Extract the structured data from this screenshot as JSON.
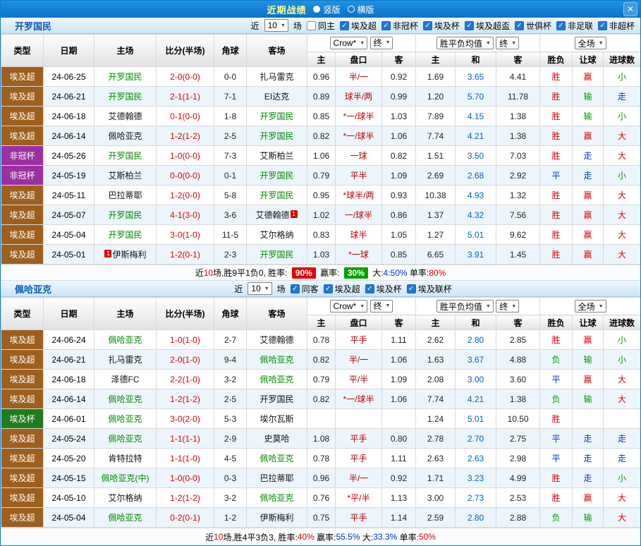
{
  "titlebar": {
    "title": "近期战绩",
    "radios": [
      {
        "label": "竖版",
        "selected": true
      },
      {
        "label": "横版",
        "selected": false
      }
    ],
    "close": "✕"
  },
  "table_head": {
    "type": "类型",
    "date": "日期",
    "home": "主场",
    "score": "比分(半场)",
    "corner": "角球",
    "away": "客场",
    "bookmaker": "Crow*",
    "final": "终",
    "avg": "胜平负均值",
    "fulltime": "全场",
    "odds_home": "主",
    "handicap": "盘口",
    "odds_away": "客",
    "eu_home": "主",
    "eu_draw": "和",
    "eu_away": "客",
    "result": "胜负",
    "hcap_result": "让球",
    "goals": "进球数"
  },
  "type_colors": {
    "埃及超": "#9d5f1e",
    "非冠杯": "#9b30a0",
    "埃及杯": "#1f7d1f"
  },
  "value_colors": {
    "胜": "#e00000",
    "平": "#0033dd",
    "负": "#009900",
    "赢": "#e00000",
    "输": "#009900",
    "走": "#0033dd",
    "大": "#e00000",
    "小": "#009900"
  },
  "sections": [
    {
      "team": "开罗国民",
      "filters": {
        "near": "近",
        "count": "10",
        "games": "场",
        "checkboxes": [
          {
            "label": "同主",
            "checked": false
          },
          {
            "label": "埃及超",
            "checked": true
          },
          {
            "label": "非冠杯",
            "checked": true
          },
          {
            "label": "埃及杯",
            "checked": true
          },
          {
            "label": "埃及超盃",
            "checked": true
          },
          {
            "label": "世俱杯",
            "checked": true
          },
          {
            "label": "非足联",
            "checked": true
          },
          {
            "label": "非超杯",
            "checked": true
          }
        ]
      },
      "rows": [
        {
          "type": "埃及超",
          "date": "24-06-25",
          "home": "开罗国民",
          "hf": true,
          "score": "2-0(0-0)",
          "corner": "0-0",
          "away": "扎马雷克",
          "af": false,
          "oh": "0.96",
          "hc": "半/一",
          "oa": "0.92",
          "eu": [
            "1.69",
            "3.65",
            "4.41"
          ],
          "res": "胜",
          "hres": "赢",
          "goal": "小"
        },
        {
          "type": "埃及超",
          "date": "24-06-21",
          "home": "开罗国民",
          "hf": true,
          "score": "2-1(1-1)",
          "corner": "7-1",
          "away": "EI达克",
          "af": false,
          "oh": "0.89",
          "hc": "球半/两",
          "oa": "0.99",
          "eu": [
            "1.20",
            "5.70",
            "11.78"
          ],
          "res": "胜",
          "hres": "输",
          "goal": "走"
        },
        {
          "type": "埃及超",
          "date": "24-06-18",
          "home": "艾德翰德",
          "hf": false,
          "score": "0-1(0-0)",
          "corner": "1-8",
          "away": "开罗国民",
          "af": true,
          "oh": "0.85",
          "hc": "*一/球半",
          "oa": "1.03",
          "eu": [
            "7.89",
            "4.15",
            "1.38"
          ],
          "res": "胜",
          "hres": "输",
          "goal": "小"
        },
        {
          "type": "埃及超",
          "date": "24-06-14",
          "home": "佩哈亚克",
          "hf": false,
          "score": "1-2(1-2)",
          "corner": "2-5",
          "away": "开罗国民",
          "af": true,
          "oh": "0.82",
          "hc": "*一/球半",
          "oa": "1.06",
          "eu": [
            "7.74",
            "4.21",
            "1.38"
          ],
          "res": "胜",
          "hres": "赢",
          "goal": "大"
        },
        {
          "type": "非冠杯",
          "date": "24-05-26",
          "home": "开罗国民",
          "hf": true,
          "score": "1-0(0-0)",
          "corner": "7-3",
          "away": "艾斯柏兰",
          "af": false,
          "oh": "1.06",
          "hc": "一球",
          "oa": "0.82",
          "eu": [
            "1.51",
            "3.50",
            "7.03"
          ],
          "res": "胜",
          "hres": "走",
          "goal": "大"
        },
        {
          "type": "非冠杯",
          "date": "24-05-19",
          "home": "艾斯柏兰",
          "hf": false,
          "score": "0-0(0-0)",
          "corner": "0-1",
          "away": "开罗国民",
          "af": true,
          "oh": "0.79",
          "hc": "平半",
          "oa": "1.09",
          "eu": [
            "2.69",
            "2.68",
            "2.92"
          ],
          "res": "平",
          "hres": "走",
          "goal": "小"
        },
        {
          "type": "埃及超",
          "date": "24-05-11",
          "home": "巴拉蒂耶",
          "hf": false,
          "score": "1-2(0-0)",
          "corner": "5-8",
          "away": "开罗国民",
          "af": true,
          "oh": "0.95",
          "hc": "*球半/两",
          "oa": "0.93",
          "eu": [
            "10.38",
            "4.93",
            "1.32"
          ],
          "res": "胜",
          "hres": "赢",
          "goal": "大"
        },
        {
          "type": "埃及超",
          "date": "24-05-07",
          "home": "开罗国民",
          "hf": true,
          "score": "4-1(3-0)",
          "corner": "3-6",
          "away": "艾德翰德",
          "af": false,
          "away_badge": "1",
          "oh": "1.02",
          "hc": "一/球半",
          "oa": "0.86",
          "eu": [
            "1.37",
            "4.32",
            "7.56"
          ],
          "res": "胜",
          "hres": "赢",
          "goal": "大"
        },
        {
          "type": "埃及超",
          "date": "24-05-04",
          "home": "开罗国民",
          "hf": true,
          "score": "3-0(1-0)",
          "corner": "11-5",
          "away": "艾尔格纳",
          "af": false,
          "oh": "0.83",
          "hc": "球半",
          "oa": "1.05",
          "eu": [
            "1.27",
            "5.01",
            "9.62"
          ],
          "res": "胜",
          "hres": "赢",
          "goal": "大"
        },
        {
          "type": "埃及超",
          "date": "24-05-01",
          "home": "伊斯梅利",
          "hf": false,
          "home_badge": "1",
          "score": "1-2(0-1)",
          "corner": "2-3",
          "away": "开罗国民",
          "af": true,
          "oh": "1.03",
          "hc": "*一球",
          "oa": "0.85",
          "eu": [
            "6.65",
            "3.91",
            "1.45"
          ],
          "res": "胜",
          "hres": "赢",
          "goal": "大"
        }
      ],
      "summary": {
        "parts": [
          {
            "t": "近"
          },
          {
            "t": "10",
            "c": "#e00000"
          },
          {
            "t": "场,胜9平1负0, 胜率: "
          },
          {
            "t": "90%",
            "badge": "#e80000"
          },
          {
            "t": " 赢率: "
          },
          {
            "t": "30%",
            "badge": "#00a000"
          },
          {
            "t": " 大:"
          },
          {
            "t": "4:50%",
            "c": "#0033dd"
          },
          {
            "t": " 单率:"
          },
          {
            "t": "80%",
            "c": "#e00000"
          }
        ]
      }
    },
    {
      "team": "佩哈亚克",
      "filters": {
        "near": "近",
        "count": "10",
        "games": "场",
        "checkboxes": [
          {
            "label": "同客",
            "checked": true
          },
          {
            "label": "埃及超",
            "checked": true
          },
          {
            "label": "埃及杯",
            "checked": true
          },
          {
            "label": "埃及联杯",
            "checked": true
          }
        ]
      },
      "rows": [
        {
          "type": "埃及超",
          "date": "24-06-24",
          "home": "佩哈亚克",
          "hf": true,
          "score": "1-0(1-0)",
          "corner": "2-7",
          "away": "艾德翰德",
          "af": false,
          "oh": "0.78",
          "hc": "平手",
          "oa": "1.11",
          "eu": [
            "2.62",
            "2.80",
            "2.85"
          ],
          "res": "胜",
          "hres": "赢",
          "goal": "小"
        },
        {
          "type": "埃及超",
          "date": "24-06-21",
          "home": "扎马雷克",
          "hf": false,
          "score": "2-0(1-0)",
          "corner": "9-4",
          "away": "佩哈亚克",
          "af": true,
          "oh": "0.82",
          "hc": "半/一",
          "oa": "1.06",
          "eu": [
            "1.63",
            "3.67",
            "4.88"
          ],
          "res": "负",
          "hres": "输",
          "goal": "小"
        },
        {
          "type": "埃及超",
          "date": "24-06-18",
          "home": "泽德FC",
          "hf": false,
          "score": "2-2(1-0)",
          "corner": "3-2",
          "away": "佩哈亚克",
          "af": true,
          "oh": "0.79",
          "hc": "平/半",
          "oa": "1.09",
          "eu": [
            "2.08",
            "3.00",
            "3.60"
          ],
          "res": "平",
          "hres": "赢",
          "goal": "大"
        },
        {
          "type": "埃及超",
          "date": "24-06-14",
          "home": "佩哈亚克",
          "hf": true,
          "score": "1-2(1-2)",
          "corner": "2-5",
          "away": "开罗国民",
          "af": false,
          "oh": "0.82",
          "hc": "*一/球半",
          "oa": "1.06",
          "eu": [
            "7.74",
            "4.21",
            "1.38"
          ],
          "res": "负",
          "hres": "输",
          "goal": "大"
        },
        {
          "type": "埃及杯",
          "date": "24-06-01",
          "home": "佩哈亚克",
          "hf": true,
          "score": "3-0(2-0)",
          "corner": "5-3",
          "away": "埃尔瓦斯",
          "af": false,
          "oh": "",
          "hc": "",
          "oa": "",
          "eu": [
            "1.24",
            "5.01",
            "10.50"
          ],
          "res": "胜",
          "hres": "",
          "goal": ""
        },
        {
          "type": "埃及超",
          "date": "24-05-24",
          "home": "佩哈亚克",
          "hf": true,
          "score": "1-1(1-1)",
          "corner": "2-9",
          "away": "史莫哈",
          "af": false,
          "oh": "1.08",
          "hc": "平手",
          "oa": "0.80",
          "eu": [
            "2.78",
            "2.70",
            "2.75"
          ],
          "res": "平",
          "hres": "走",
          "goal": "走"
        },
        {
          "type": "埃及超",
          "date": "24-05-20",
          "home": "肯特拉特",
          "hf": false,
          "score": "1-1(1-0)",
          "corner": "4-5",
          "away": "佩哈亚克",
          "af": true,
          "oh": "0.78",
          "hc": "平手",
          "oa": "1.11",
          "eu": [
            "2.63",
            "2.63",
            "2.98"
          ],
          "res": "平",
          "hres": "走",
          "goal": "走"
        },
        {
          "type": "埃及超",
          "date": "24-05-15",
          "home": "佩哈亚克(中)",
          "hf": true,
          "score": "1-0(0-0)",
          "corner": "0-3",
          "away": "巴拉蒂耶",
          "af": false,
          "oh": "0.96",
          "hc": "半/一",
          "oa": "0.92",
          "eu": [
            "1.71",
            "3.23",
            "4.99"
          ],
          "res": "胜",
          "hres": "走",
          "goal": "小"
        },
        {
          "type": "埃及超",
          "date": "24-05-10",
          "home": "艾尔格纳",
          "hf": false,
          "score": "1-2(1-2)",
          "corner": "3-2",
          "away": "佩哈亚克",
          "af": true,
          "oh": "0.76",
          "hc": "*平/半",
          "oa": "1.13",
          "eu": [
            "3.00",
            "2.73",
            "2.53"
          ],
          "res": "胜",
          "hres": "赢",
          "goal": "大"
        },
        {
          "type": "埃及超",
          "date": "24-05-04",
          "home": "佩哈亚克",
          "hf": true,
          "score": "0-2(0-1)",
          "corner": "1-2",
          "away": "伊斯梅利",
          "af": false,
          "oh": "0.75",
          "hc": "平手",
          "oa": "1.14",
          "eu": [
            "2.59",
            "2.80",
            "2.88"
          ],
          "res": "负",
          "hres": "输",
          "goal": "大"
        }
      ],
      "summary": {
        "parts": [
          {
            "t": "近"
          },
          {
            "t": "10",
            "c": "#e00000"
          },
          {
            "t": "场,胜4平3负3, 胜率:"
          },
          {
            "t": "40%",
            "c": "#e00000"
          },
          {
            "t": " 赢率:"
          },
          {
            "t": "55.5%",
            "c": "#0033dd"
          },
          {
            "t": " 大:"
          },
          {
            "t": "33.3%",
            "c": "#0033dd"
          },
          {
            "t": " 单率:"
          },
          {
            "t": "50%",
            "c": "#e00000"
          }
        ]
      }
    }
  ]
}
